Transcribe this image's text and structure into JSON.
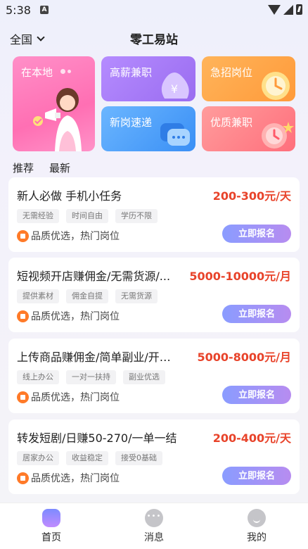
{
  "status": {
    "time": "5:38"
  },
  "header": {
    "region": "全国",
    "title": "零工易站"
  },
  "tiles": [
    {
      "label": "在本地",
      "icon": "girl-megaphone-icon"
    },
    {
      "label": "高薪兼职",
      "icon": "money-bag-icon"
    },
    {
      "label": "急招岗位",
      "icon": "clock-icon"
    },
    {
      "label": "新岗速递",
      "icon": "chat-bubble-icon"
    },
    {
      "label": "优质兼职",
      "icon": "clock-star-icon"
    }
  ],
  "tabs": [
    "推荐",
    "最新"
  ],
  "jobs": [
    {
      "title": "新人必做 手机小任务",
      "salary": "200-300元/天",
      "tags": [
        "无需经验",
        "时间自由",
        "学历不限"
      ],
      "note": "品质优选，热门岗位",
      "button": "立即报名"
    },
    {
      "title": "短视频开店赚佣金/无需货源/...",
      "salary": "5000-10000元/月",
      "tags": [
        "提供素材",
        "佣金自提",
        "无需货源"
      ],
      "note": "品质优选，热门岗位",
      "button": "立即报名"
    },
    {
      "title": "上传商品赚佣金/简单副业/开…",
      "salary": "5000-8000元/月",
      "tags": [
        "线上办公",
        "一对一扶持",
        "副业优选"
      ],
      "note": "品质优选，热门岗位",
      "button": "立即报名"
    },
    {
      "title": "转发短剧/日赚50-270/一单一结",
      "salary": "200-400元/天",
      "tags": [
        "居家办公",
        "收益稳定",
        "接受0基础"
      ],
      "note": "品质优选，热门岗位",
      "button": "立即报名"
    }
  ],
  "nav": [
    "首页",
    "消息",
    "我的"
  ]
}
